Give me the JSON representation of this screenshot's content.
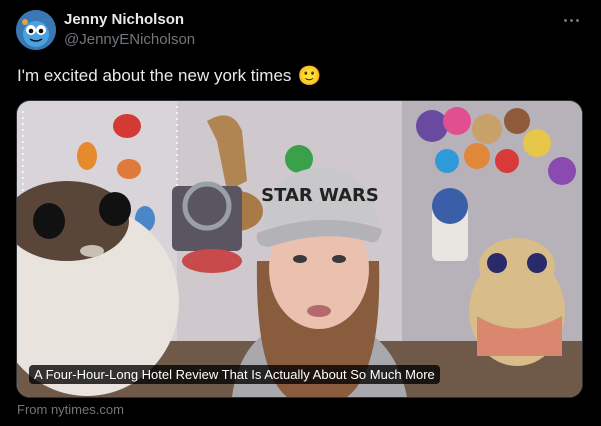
{
  "author": {
    "display_name": "Jenny Nicholson",
    "handle": "@JennyENicholson",
    "avatar_icon": "avatar-cartoon-icon"
  },
  "tweet": {
    "text": "I'm excited about the new york times",
    "emoji": "🙂"
  },
  "card": {
    "headline": "A Four-Hour-Long Hotel Review That Is Actually About So Much More",
    "source": "From nytimes.com",
    "cap_text": "STAR WARS"
  },
  "colors": {
    "background": "#000000",
    "primary_text": "#e7e9ea",
    "secondary_text": "#71767b"
  }
}
